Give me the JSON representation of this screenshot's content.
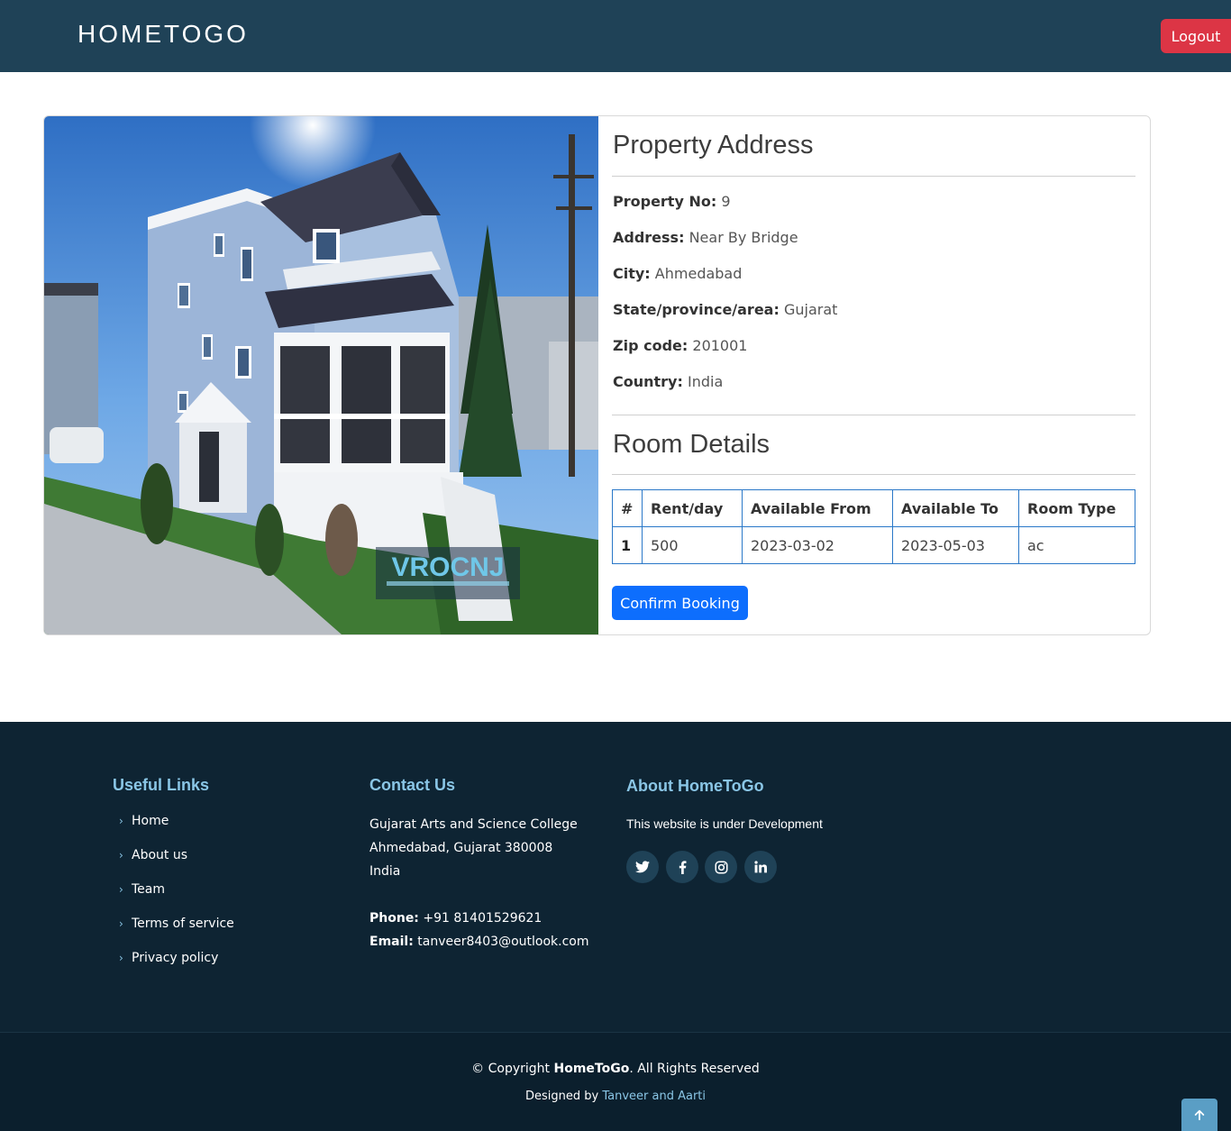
{
  "header": {
    "brand": "HOMETOGO",
    "logout_label": "Logout",
    "logout_color": "#dc3545",
    "bg_color": "#1f4257"
  },
  "property": {
    "image_watermark": "VROCNJ",
    "address_title": "Property Address",
    "fields": [
      {
        "label": "Property No:",
        "value": "9"
      },
      {
        "label": "Address:",
        "value": "Near By Bridge"
      },
      {
        "label": "City:",
        "value": "Ahmedabad"
      },
      {
        "label": "State/province/area:",
        "value": "Gujarat"
      },
      {
        "label": "Zip code:",
        "value": "201001"
      },
      {
        "label": "Country:",
        "value": "India"
      }
    ],
    "room_title": "Room Details",
    "room_table": {
      "headers": [
        "#",
        "Rent/day",
        "Available From",
        "Available To",
        "Room Type"
      ],
      "rows": [
        [
          "1",
          "500",
          "2023-03-02",
          "2023-05-03",
          "ac"
        ]
      ]
    },
    "confirm_label": "Confirm Booking",
    "confirm_color": "#0d6efd"
  },
  "footer": {
    "useful_links_title": "Useful Links",
    "useful_links": [
      "Home",
      "About us",
      "Team",
      "Terms of service",
      "Privacy policy"
    ],
    "contact_title": "Contact Us",
    "contact_lines": [
      "Gujarat Arts and Science College",
      "Ahmedabad, Gujarat 380008",
      "India"
    ],
    "phone_label": "Phone:",
    "phone_value": "+91 81401529621",
    "email_label": "Email:",
    "email_value": "tanveer8403@outlook.com",
    "about_title": "About HomeToGo",
    "about_text": "This website is under Development",
    "social_icons": [
      "twitter-icon",
      "facebook-icon",
      "instagram-icon",
      "linkedin-icon"
    ],
    "bg_color": "#0e2433",
    "accent_color": "#8ac6e6"
  },
  "bottom": {
    "copyright_prefix": "© Copyright",
    "copyright_brand": "HomeToGo",
    "copyright_suffix": ". All Rights Reserved",
    "designed_by_prefix": "Designed by",
    "designed_by_names": "Tanveer and Aarti"
  }
}
